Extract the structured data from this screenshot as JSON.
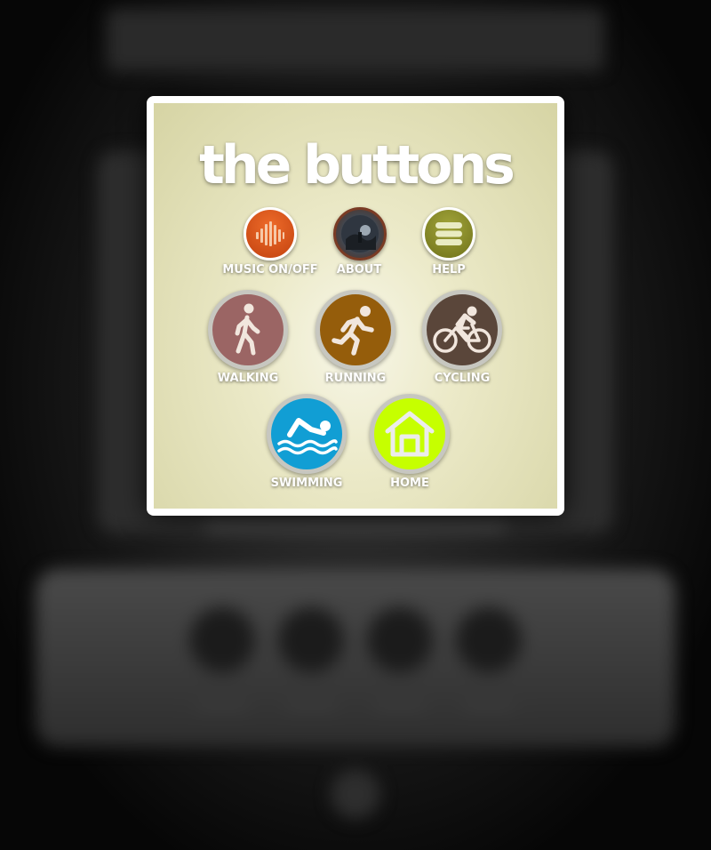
{
  "modal": {
    "title": "the buttons"
  },
  "menu": {
    "music": {
      "label": "MUSIC ON/OFF",
      "icon": "equalizer-icon",
      "color": "#d9541a"
    },
    "about": {
      "label": "ABOUT",
      "icon": "about-photo-icon",
      "color": "#6b3a22"
    },
    "help": {
      "label": "HELP",
      "icon": "menu-lines-icon",
      "color": "#8a8c22"
    }
  },
  "activities": {
    "walking": {
      "label": "WALKING",
      "icon": "walking-person-icon",
      "color": "#9b6564"
    },
    "running": {
      "label": "RUNNING",
      "icon": "running-person-icon",
      "color": "#955d0b"
    },
    "cycling": {
      "label": "CYCLING",
      "icon": "cyclist-icon",
      "color": "#5a463a"
    },
    "swimming": {
      "label": "SWIMMING",
      "icon": "swimmer-icon",
      "color": "#119ed4"
    },
    "home": {
      "label": "HOME",
      "icon": "house-icon",
      "color": "#c6ff00"
    }
  }
}
